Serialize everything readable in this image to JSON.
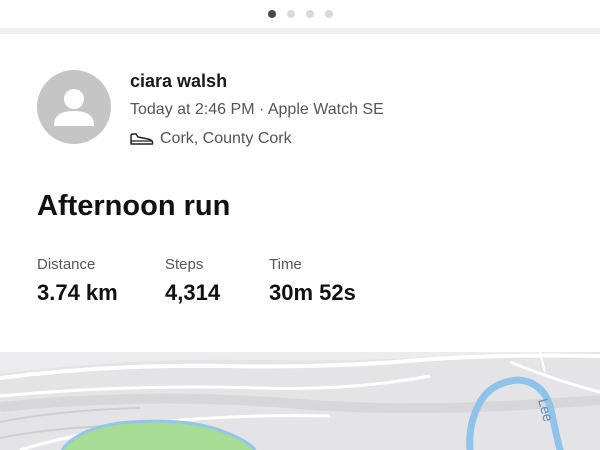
{
  "pager": {
    "active_index": 0,
    "total": 4
  },
  "activity": {
    "user_name": "ciara walsh",
    "meta": "Today at 2:46 PM · Apple Watch SE",
    "location": "Cork, County Cork",
    "title": "Afternoon run",
    "stats": [
      {
        "label": "Distance",
        "value": "3.74 km"
      },
      {
        "label": "Steps",
        "value": "4,314"
      },
      {
        "label": "Time",
        "value": "30m 52s"
      }
    ]
  },
  "map": {
    "river_label": "Lee"
  },
  "colors": {
    "avatar_bg": "#c5c5c5",
    "river": "#8fc3ea",
    "park": "#a6dc94",
    "map_bg": "#e4e4e6"
  },
  "icons": {
    "avatar": "person-silhouette-icon",
    "activity_type": "running-shoe-icon"
  }
}
